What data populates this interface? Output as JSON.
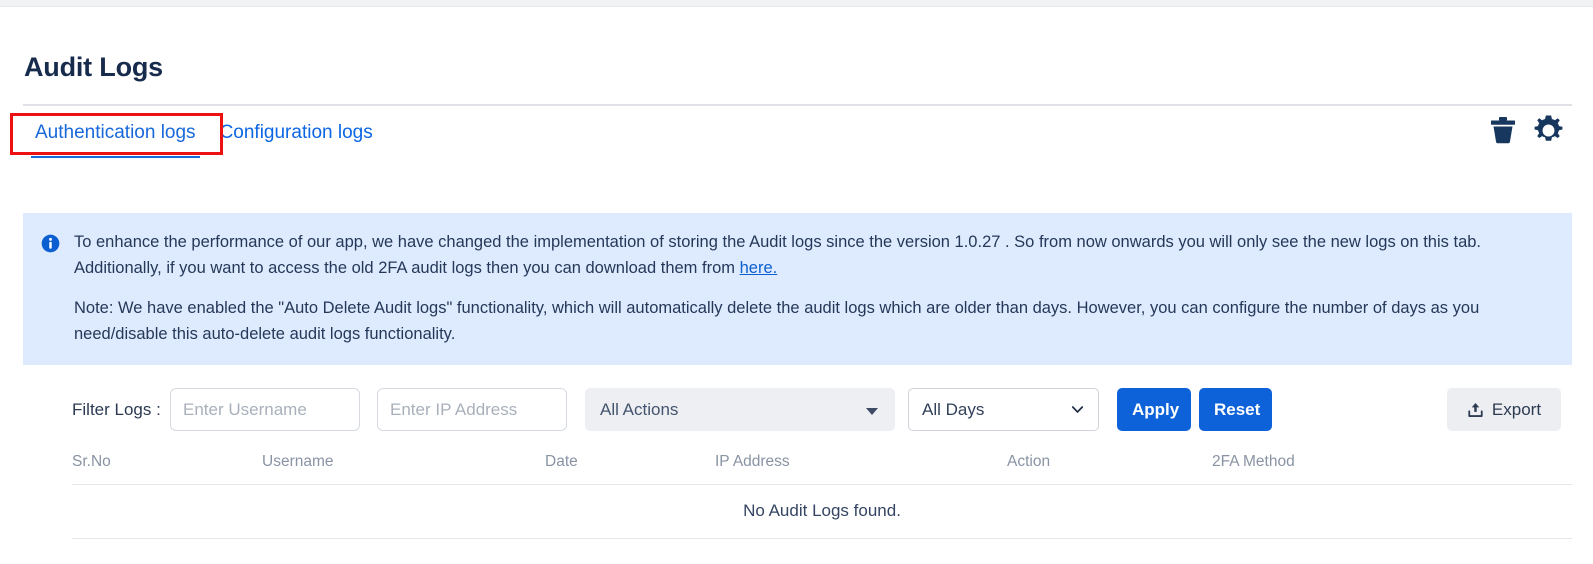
{
  "page": {
    "title": "Audit Logs"
  },
  "tabs": [
    {
      "label": "Authentication logs",
      "active": true
    },
    {
      "label": "Configuration logs",
      "active": false
    }
  ],
  "tab_actions": [
    {
      "name": "delete-logs",
      "icon": "trash-icon"
    },
    {
      "name": "settings",
      "icon": "gear-icon"
    }
  ],
  "banner": {
    "icon": "info-icon",
    "paragraph1_before_link": "To enhance the performance of our app, we have changed the implementation of storing the Audit logs since the version 1.0.27 . So from now onwards you will only see the new logs on this tab. Additionally, if you want to access the old 2FA audit logs then you can download them from ",
    "link_text": "here.",
    "paragraph2": "Note: We have enabled the \"Auto Delete Audit logs\" functionality, which will automatically delete the audit logs which are older than days. However, you can configure the number of days as you need/disable this auto-delete audit logs functionality."
  },
  "filters": {
    "label": "Filter Logs :",
    "username_placeholder": "Enter Username",
    "username_value": "",
    "ip_placeholder": "Enter IP Address",
    "ip_value": "",
    "action_selected": "All Actions",
    "action_options": [
      "All Actions"
    ],
    "days_selected": "All Days",
    "days_options": [
      "All Days"
    ],
    "apply_label": "Apply",
    "reset_label": "Reset",
    "export_label": "Export"
  },
  "table": {
    "columns": [
      "Sr.No",
      "Username",
      "Date",
      "IP Address",
      "Action",
      "2FA Method"
    ],
    "rows": [],
    "empty_message": "No Audit Logs found."
  },
  "colors": {
    "accent_blue": "#0d62d9",
    "link_blue": "#0c66e4",
    "banner_bg": "#deebff",
    "icon_navy": "#17375e",
    "annotation_red": "#ee1111"
  }
}
